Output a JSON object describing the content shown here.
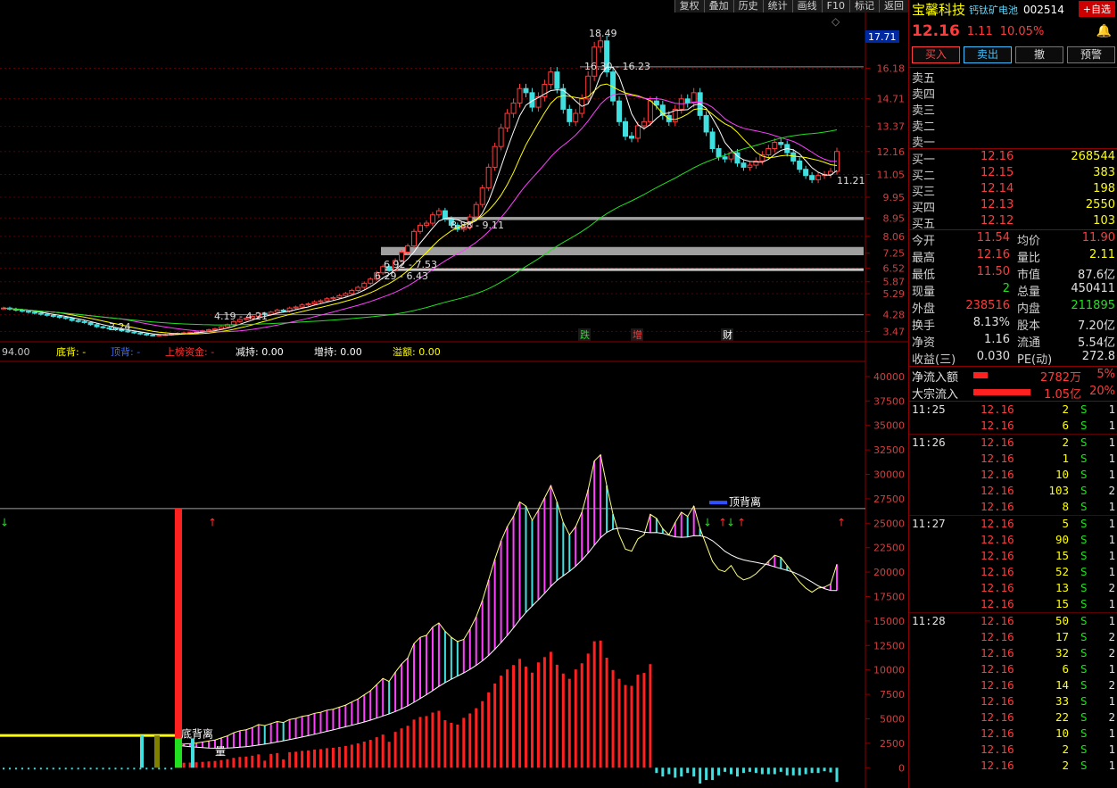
{
  "toolbar": [
    "复权",
    "叠加",
    "历史",
    "统计",
    "画线",
    "F10",
    "标记",
    "返回"
  ],
  "stock": {
    "name": "宝馨科技",
    "concept": "钙钛矿电池",
    "code": "002514",
    "add_label": "+自选",
    "price": "12.16",
    "change": "1.11",
    "change_pct": "10.05%"
  },
  "actions": {
    "buy": "买入",
    "sell": "卖出",
    "cancel": "撤",
    "alert": "预警"
  },
  "order_book": {
    "asks": [
      {
        "label": "卖五"
      },
      {
        "label": "卖四"
      },
      {
        "label": "卖三"
      },
      {
        "label": "卖二"
      },
      {
        "label": "卖一"
      }
    ],
    "bids": [
      {
        "label": "买一",
        "price": "12.16",
        "vol": "268544"
      },
      {
        "label": "买二",
        "price": "12.15",
        "vol": "383"
      },
      {
        "label": "买三",
        "price": "12.14",
        "vol": "198"
      },
      {
        "label": "买四",
        "price": "12.13",
        "vol": "2550"
      },
      {
        "label": "买五",
        "price": "12.12",
        "vol": "103"
      }
    ]
  },
  "quote_rows": [
    [
      "今开",
      "11.54",
      "均价",
      "11.90"
    ],
    [
      "最高",
      "12.16",
      "量比",
      "2.11"
    ],
    [
      "最低",
      "11.50",
      "市值",
      "87.6亿"
    ],
    [
      "现量",
      "2",
      "总量",
      "450411"
    ],
    [
      "外盘",
      "238516",
      "内盘",
      "211895"
    ],
    [
      "换手",
      "8.13%",
      "股本",
      "7.20亿"
    ],
    [
      "净资",
      "1.16",
      "流通",
      "5.54亿"
    ],
    [
      "收益(三)",
      "0.030",
      "PE(动)",
      "272.8"
    ]
  ],
  "flows": [
    {
      "label": "净流入额",
      "value": "2782万",
      "pct": "5%",
      "share": 0.2
    },
    {
      "label": "大宗流入",
      "value": "1.05亿",
      "pct": "20%",
      "share": 0.8
    }
  ],
  "ticks": [
    [
      "11:25",
      "12.16",
      "2",
      "S",
      "1"
    ],
    [
      "",
      "12.16",
      "6",
      "S",
      "1"
    ],
    [
      "11:26",
      "12.16",
      "2",
      "S",
      "1"
    ],
    [
      "",
      "12.16",
      "1",
      "S",
      "1"
    ],
    [
      "",
      "12.16",
      "10",
      "S",
      "1"
    ],
    [
      "",
      "12.16",
      "103",
      "S",
      "2"
    ],
    [
      "",
      "12.16",
      "8",
      "S",
      "1"
    ],
    [
      "11:27",
      "12.16",
      "5",
      "S",
      "1"
    ],
    [
      "",
      "12.16",
      "90",
      "S",
      "1"
    ],
    [
      "",
      "12.16",
      "15",
      "S",
      "1"
    ],
    [
      "",
      "12.16",
      "52",
      "S",
      "1"
    ],
    [
      "",
      "12.16",
      "13",
      "S",
      "2"
    ],
    [
      "",
      "12.16",
      "15",
      "S",
      "1"
    ],
    [
      "11:28",
      "12.16",
      "50",
      "S",
      "1"
    ],
    [
      "",
      "12.16",
      "17",
      "S",
      "2"
    ],
    [
      "",
      "12.16",
      "32",
      "S",
      "2"
    ],
    [
      "",
      "12.16",
      "6",
      "S",
      "1"
    ],
    [
      "",
      "12.16",
      "14",
      "S",
      "2"
    ],
    [
      "",
      "12.16",
      "33",
      "S",
      "1"
    ],
    [
      "",
      "12.16",
      "22",
      "S",
      "2"
    ],
    [
      "",
      "12.16",
      "10",
      "S",
      "1"
    ],
    [
      "",
      "12.16",
      "2",
      "S",
      "1"
    ],
    [
      "",
      "12.16",
      "2",
      "S",
      "1"
    ]
  ],
  "chart_data": [
    {
      "type": "candlestick",
      "current_price_label": "17.71",
      "y_ticks": [
        16.18,
        14.71,
        13.37,
        12.16,
        11.05,
        9.95,
        8.95,
        8.06,
        7.25,
        6.52,
        5.87,
        5.29,
        4.28,
        3.47
      ],
      "y_range": [
        3.1,
        18.7
      ],
      "annotations": [
        "18.49",
        "16.30 - 16.23",
        "8.88 - 9.11",
        "6.92 - 7.53",
        "6.29 - 6.43",
        "4.19 - 4.21",
        "3.24",
        "11.21"
      ],
      "resistance_bands": [
        [
          8.85,
          9.0
        ],
        [
          7.15,
          7.55
        ],
        [
          6.45,
          6.52
        ]
      ],
      "h_lines": [
        16.25,
        4.28
      ],
      "event_labels": [
        "跌",
        "增",
        "财"
      ],
      "closes": [
        4.6,
        4.55,
        4.5,
        4.45,
        4.4,
        4.35,
        4.3,
        4.25,
        4.2,
        4.15,
        4.1,
        4.0,
        3.95,
        3.9,
        3.8,
        3.7,
        3.65,
        3.6,
        3.55,
        3.5,
        3.45,
        3.4,
        3.35,
        3.3,
        3.28,
        3.3,
        3.32,
        3.35,
        3.38,
        3.4,
        3.42,
        3.45,
        3.5,
        3.55,
        3.6,
        3.7,
        3.8,
        3.95,
        4.05,
        4.1,
        4.2,
        4.35,
        4.3,
        4.4,
        4.5,
        4.45,
        4.6,
        4.65,
        4.75,
        4.8,
        4.9,
        4.95,
        5.05,
        5.1,
        5.2,
        5.3,
        5.45,
        5.6,
        5.8,
        6.0,
        6.3,
        6.6,
        6.45,
        6.9,
        7.3,
        7.6,
        8.3,
        8.6,
        8.7,
        9.1,
        9.3,
        8.9,
        8.6,
        8.4,
        8.5,
        9.0,
        9.6,
        10.4,
        11.4,
        12.4,
        13.3,
        14.0,
        14.5,
        15.2,
        15.0,
        14.3,
        14.8,
        15.4,
        16.0,
        15.2,
        14.2,
        13.6,
        14.0,
        14.7,
        15.8,
        17.2,
        17.5,
        16.0,
        14.6,
        13.6,
        12.9,
        12.8,
        13.4,
        13.6,
        14.6,
        14.4,
        13.9,
        13.6,
        14.2,
        14.7,
        14.5,
        15.0,
        13.9,
        13.1,
        12.3,
        11.9,
        11.8,
        12.1,
        11.6,
        11.4,
        11.5,
        11.7,
        12.0,
        12.3,
        12.6,
        12.5,
        12.1,
        11.7,
        11.3,
        11.0,
        10.8,
        11.0,
        11.05,
        11.2,
        12.16
      ]
    },
    {
      "type": "bar",
      "legend": [
        {
          "text": "94.00",
          "color": "#c8c8c8"
        },
        {
          "text": "底背: -",
          "color": "#ffff00"
        },
        {
          "text": "顶背: -",
          "color": "#3a6bff"
        },
        {
          "text": "上榜资金: -",
          "color": "#ff3030"
        },
        {
          "text": "减持: 0.00",
          "color": "#ffffff"
        },
        {
          "text": "增持: 0.00",
          "color": "#ffffff"
        },
        {
          "text": "溢额: 0.00",
          "color": "#ffff00"
        }
      ],
      "y_ticks": [
        40000,
        37500,
        35000,
        32500,
        30000,
        27500,
        25000,
        22500,
        20000,
        17500,
        15000,
        12500,
        10000,
        7500,
        5000,
        2500,
        0
      ],
      "y_range": [
        -1800,
        42000
      ],
      "h_line": 26500,
      "labels": [
        "底背离",
        "顶背离",
        "量"
      ]
    }
  ]
}
